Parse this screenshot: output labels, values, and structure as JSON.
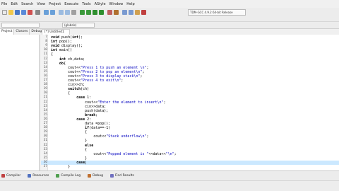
{
  "menu": [
    "File",
    "Edit",
    "Search",
    "View",
    "Project",
    "Execute",
    "Tools",
    "AStyle",
    "Window",
    "Help"
  ],
  "toolbar": {
    "compiler": "TDM-GCC 4.9.2 64-bit Release",
    "scope_value": "(globals)"
  },
  "left_panel": {
    "tabs": [
      "Project",
      "Classes",
      "Debug"
    ]
  },
  "editor": {
    "file_tab": "[*] Untitled1",
    "lines": [
      {
        "n": "7",
        "code": "void push(int);"
      },
      {
        "n": "8",
        "code": "int pop();"
      },
      {
        "n": "9",
        "code": "void display();"
      },
      {
        "n": "10",
        "code": "int main()"
      },
      {
        "n": "11",
        "code": "{"
      },
      {
        "n": "12",
        "code": "    int ch,data;"
      },
      {
        "n": "13",
        "code": "    do{"
      },
      {
        "n": "14",
        "code": "        cout<<\"Press 1 to push an element \\n\";"
      },
      {
        "n": "15",
        "code": "        cout<<\"Press 2 to pop an element\\n\";"
      },
      {
        "n": "16",
        "code": "        cout<<\"Press 3 to display stack\\n\";"
      },
      {
        "n": "17",
        "code": "        cout<<\"Press 4 to exit\\n\";"
      },
      {
        "n": "18",
        "code": "        cin>>ch;"
      },
      {
        "n": "19",
        "code": "        switch(ch)"
      },
      {
        "n": "20",
        "code": "        {"
      },
      {
        "n": "21",
        "code": "            case 1:"
      },
      {
        "n": "22",
        "code": "                cout<<\"Enter the element to insert\\n\";"
      },
      {
        "n": "23",
        "code": "                cin>>data;"
      },
      {
        "n": "24",
        "code": "                push(data);"
      },
      {
        "n": "25",
        "code": "                break;"
      },
      {
        "n": "26",
        "code": "            case 2:"
      },
      {
        "n": "27",
        "code": "                data =pop();"
      },
      {
        "n": "28",
        "code": "                if(data==-1)"
      },
      {
        "n": "29",
        "code": "                {"
      },
      {
        "n": "30",
        "code": "                    cout<<\"Stack underflow\\n\";"
      },
      {
        "n": "31",
        "code": "                }"
      },
      {
        "n": "32",
        "code": "                else"
      },
      {
        "n": "33",
        "code": "                {"
      },
      {
        "n": "34",
        "code": "                    cout<<\"Popped element is \"<<data<<\"\\n\";"
      },
      {
        "n": "35",
        "code": "                }"
      },
      {
        "n": "36",
        "code": "            case|"
      },
      {
        "n": "37",
        "code": "        }"
      }
    ]
  },
  "bottom_tabs": [
    "Compiler",
    "Resources",
    "Compile Log",
    "Debug",
    "Find Results"
  ]
}
